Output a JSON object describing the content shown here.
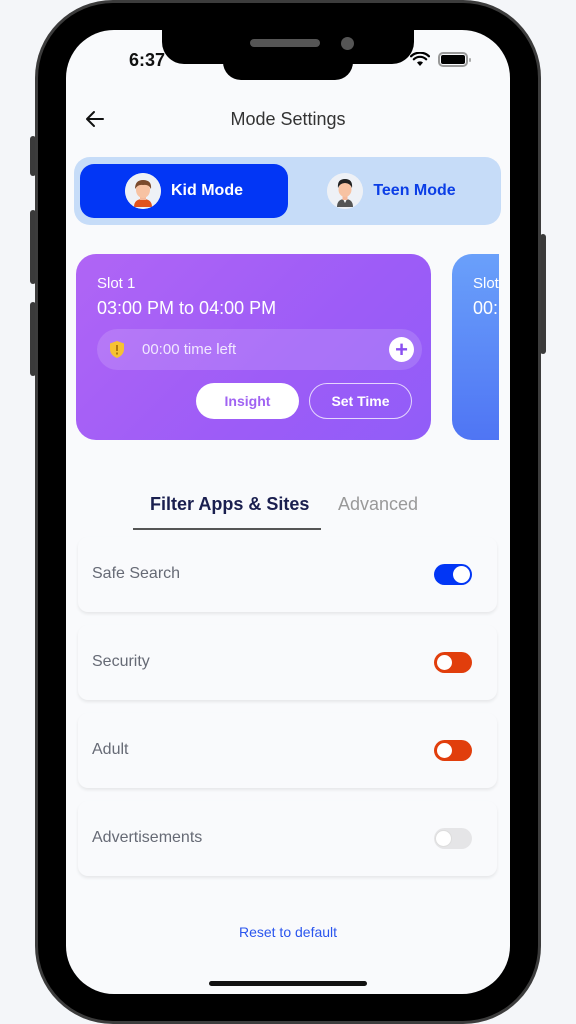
{
  "status_bar": {
    "time": "6:37"
  },
  "header": {
    "title": "Mode Settings",
    "back_icon": "arrow-left-icon"
  },
  "mode_switch": {
    "modes": [
      {
        "label": "Kid Mode",
        "avatar": "kid-avatar",
        "active": true
      },
      {
        "label": "Teen Mode",
        "avatar": "teen-avatar",
        "active": false
      }
    ]
  },
  "slots": [
    {
      "label": "Slot 1",
      "range": "03:00 PM to 04:00 PM",
      "time_left": "00:00 time left",
      "insight_label": "Insight",
      "set_time_label": "Set Time"
    },
    {
      "label": "Slot",
      "range": "00:"
    }
  ],
  "tabs": [
    {
      "label": "Filter Apps & Sites",
      "active": true
    },
    {
      "label": "Advanced",
      "active": false
    }
  ],
  "settings": [
    {
      "label": "Safe Search",
      "enabled": true,
      "color": "#0236f5"
    },
    {
      "label": "Security",
      "enabled": false,
      "color": "#e13e0c"
    },
    {
      "label": "Adult",
      "enabled": false,
      "color": "#e13e0c"
    },
    {
      "label": "Advertisements",
      "enabled": false,
      "color": "#e5e5e7"
    }
  ],
  "footer": {
    "reset_label": "Reset to default"
  },
  "colors": {
    "primary": "#0236f5",
    "slot_purple": "#a763f6",
    "slot_blue": "#5a86f6",
    "danger": "#e13e0c"
  }
}
